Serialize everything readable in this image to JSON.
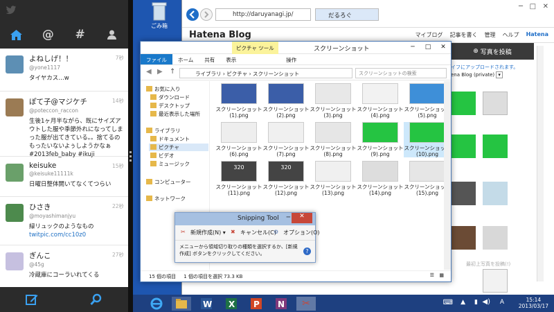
{
  "twitter": {
    "tabs": [
      "home",
      "at",
      "hash",
      "me"
    ],
    "tweets": [
      {
        "name": "よねしげ！！",
        "handle": "@yone1117",
        "time": "7秒",
        "text": "タイヤカス…w",
        "link": "",
        "avatar_color": "#5d8fb4"
      },
      {
        "name": "ぽて子@マジケチ",
        "handle": "@poteccon_raccon",
        "time": "14秒",
        "text": "生後1ヶ月半ながら、既にサイズアウトした服や季節外れになってしまった服が出てきている。。捨てるのもったいないよぅしようかなぁ #2013feb_baby #ikuji",
        "link": "",
        "avatar_color": "#9b7b54"
      },
      {
        "name": "keisuke",
        "handle": "@keisuke11111k",
        "time": "15秒",
        "text": "日曜日整体開いてなくてつらい",
        "link": "",
        "avatar_color": "#6aa06a"
      },
      {
        "name": "ひさき",
        "handle": "@moyashimanjyu",
        "time": "22秒",
        "text": "緑リュックのようなもの",
        "link": "twitpic.com/cc10z0",
        "avatar_color": "#4d8a4d"
      },
      {
        "name": "ぎんこ",
        "handle": "@45g",
        "time": "27秒",
        "text": "冷蔵庫にコーラいれてくる",
        "link": "",
        "avatar_color": "#c6c0e0"
      }
    ]
  },
  "desktop": {
    "recycle_label": "ごみ箱"
  },
  "ie": {
    "url": "http://daruyanagi.jp/",
    "tab_title": "だるろぐ",
    "hatena": {
      "logo": "Hatena Blog",
      "menu": [
        "マイブログ",
        "記事を書く",
        "管理",
        "ヘルプ",
        "Hatena"
      ],
      "post_button": "写真を投稿",
      "upload_note": "イフにアップロードされます。",
      "select_value": "ena Blog (private)",
      "upload_hint": "最初上写真を投稿(!)"
    }
  },
  "explorer": {
    "tool_tag": "ピクチャ ツール",
    "title": "スクリーンショット",
    "ribbon": [
      "ファイル",
      "ホーム",
      "共有",
      "表示",
      "操作"
    ],
    "path": "ライブラリ › ピクチャ › スクリーンショット",
    "search_placeholder": "スクリーンショットの検索",
    "nav": {
      "favorites": "お気に入り",
      "downloads": "ダウンロード",
      "desktop": "デスクトップ",
      "recent": "最近表示した場所",
      "libraries": "ライブラリ",
      "documents": "ドキュメント",
      "pictures": "ピクチャ",
      "videos": "ビデオ",
      "music": "ミュージック",
      "computer": "コンピューター",
      "network": "ネットワーク"
    },
    "files": [
      {
        "name": "スクリーンショット (1).png",
        "color": "#3b5ea8"
      },
      {
        "name": "スクリーンショット (2).png",
        "color": "#3b5ea8"
      },
      {
        "name": "スクリーンショット (3).png",
        "color": "#e8e8e8"
      },
      {
        "name": "スクリーンショット (4).png",
        "color": "#f2f2f2"
      },
      {
        "name": "スクリーンショット (5).png",
        "color": "#3e8fd8"
      },
      {
        "name": "スクリーンショット (6).png",
        "color": "#eeeeee"
      },
      {
        "name": "スクリーンショット (7).png",
        "color": "#f0f0f0"
      },
      {
        "name": "スクリーンショット (8).png",
        "color": "#e6e6e6"
      },
      {
        "name": "スクリーンショット (9).png",
        "color": "#25c442"
      },
      {
        "name": "スクリーンショット (10).png",
        "color": "#25c442"
      },
      {
        "name": "スクリーンショット (11).png",
        "color": "#444444"
      },
      {
        "name": "スクリーンショット (12).png",
        "color": "#444444"
      },
      {
        "name": "スクリーンショット (13).png",
        "color": "#f0f0f0"
      },
      {
        "name": "スクリーンショット (14).png",
        "color": "#dddddd"
      },
      {
        "name": "スクリーンショット (15).png",
        "color": "#e6e6e6"
      }
    ],
    "thumb_badge": "320",
    "status_count": "15 個の項目",
    "status_selected": "1 個の項目を選択  73.3 KB"
  },
  "snipping": {
    "title": "Snipping Tool",
    "new_label": "新規作成(N)",
    "cancel_label": "キャンセル(C)",
    "options_label": "オプション(O)",
    "message": "メニューから領域切り取りの種類を選択するか、[新規作成] ボタンをクリックしてください。"
  },
  "taskbar": {
    "apps": [
      "ie",
      "explorer",
      "word",
      "excel",
      "powerpoint",
      "onenote",
      "snipping-tool"
    ],
    "time": "15:14",
    "date": "2013/03/17"
  },
  "colors": {
    "twitter_accent": "#3aa0f0",
    "desktop": "#1e56b0",
    "explorer_file_tab": "#1979ca",
    "snip_close": "#c74739"
  }
}
